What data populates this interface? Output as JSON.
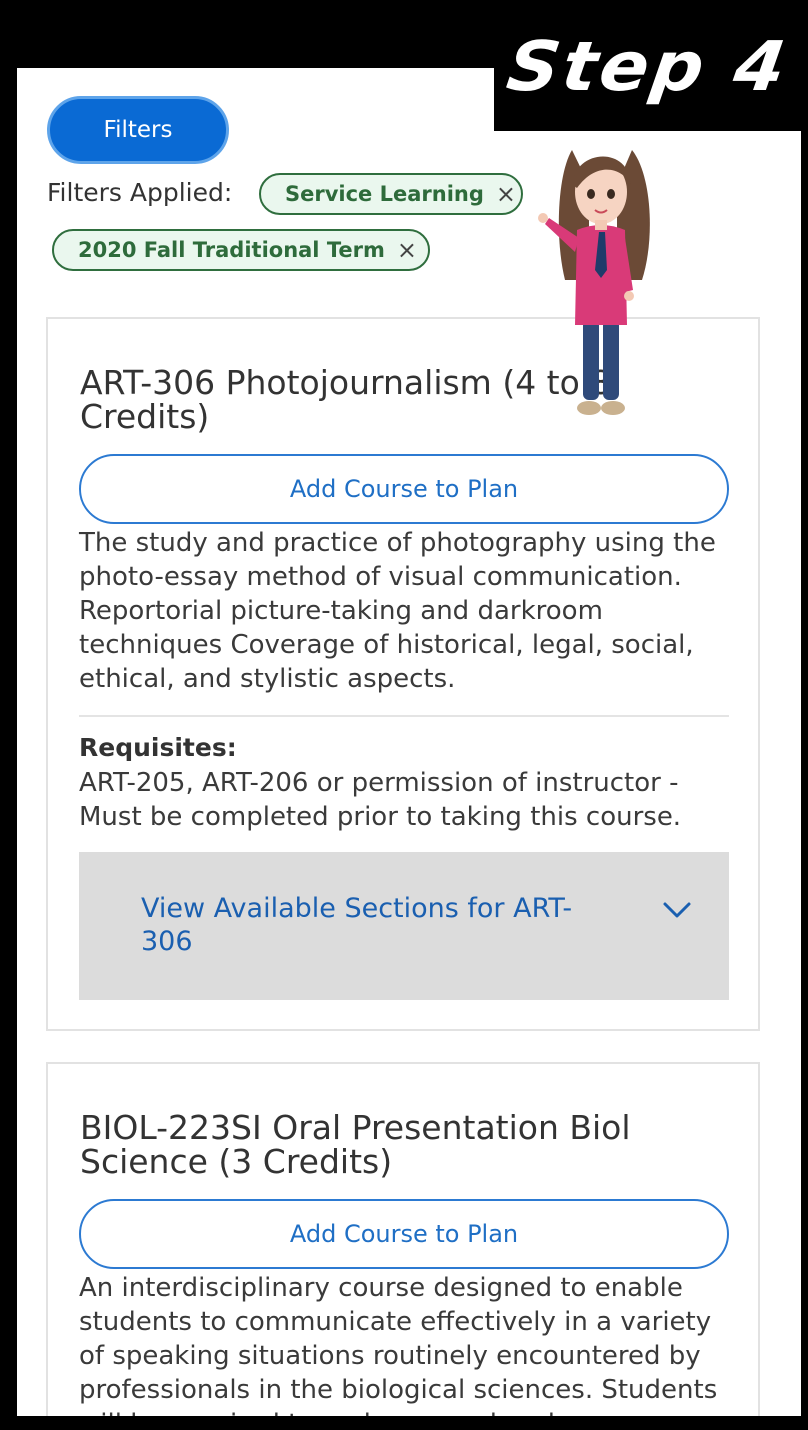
{
  "banner": {
    "step_text": "Step 4"
  },
  "filters": {
    "button_label": "Filters",
    "applied_label": "Filters Applied:",
    "chips": [
      {
        "label": "Service Learning",
        "remove": "×"
      },
      {
        "label": "2020 Fall Traditional Term",
        "remove": "×"
      }
    ]
  },
  "courses": [
    {
      "title": "ART-306 Photojournalism (4 to 8 Credits)",
      "add_label": "Add Course to Plan",
      "description": "The study and practice of photography using the photo-essay method of visual communication. Reportorial picture-taking and darkroom techniques Coverage of historical, legal, social, ethical, and stylistic aspects.",
      "requisites_label": "Requisites:",
      "requisites_text": "ART-205, ART-206 or permission of instructor - Must be completed prior to taking this course.",
      "sections_label": "View Available Sections for ART-306"
    },
    {
      "title": "BIOL-223SI Oral Presentation Biol Science (3 Credits)",
      "add_label": "Add Course to Plan",
      "description": "An interdisciplinary course designed to enable students to communicate effectively in a variety of speaking situations routinely encountered by professionals in the biological sciences. Students will be required to make several oral"
    }
  ],
  "colors": {
    "primary_blue": "#0a6ad4",
    "link_blue": "#1f6fc5",
    "chip_green": "#2e6b3b",
    "chip_bg": "#eaf7ee",
    "sections_bg": "#dcdcdc"
  },
  "icons": {
    "chip_remove": "close-icon",
    "sections_toggle": "chevron-down-icon"
  }
}
